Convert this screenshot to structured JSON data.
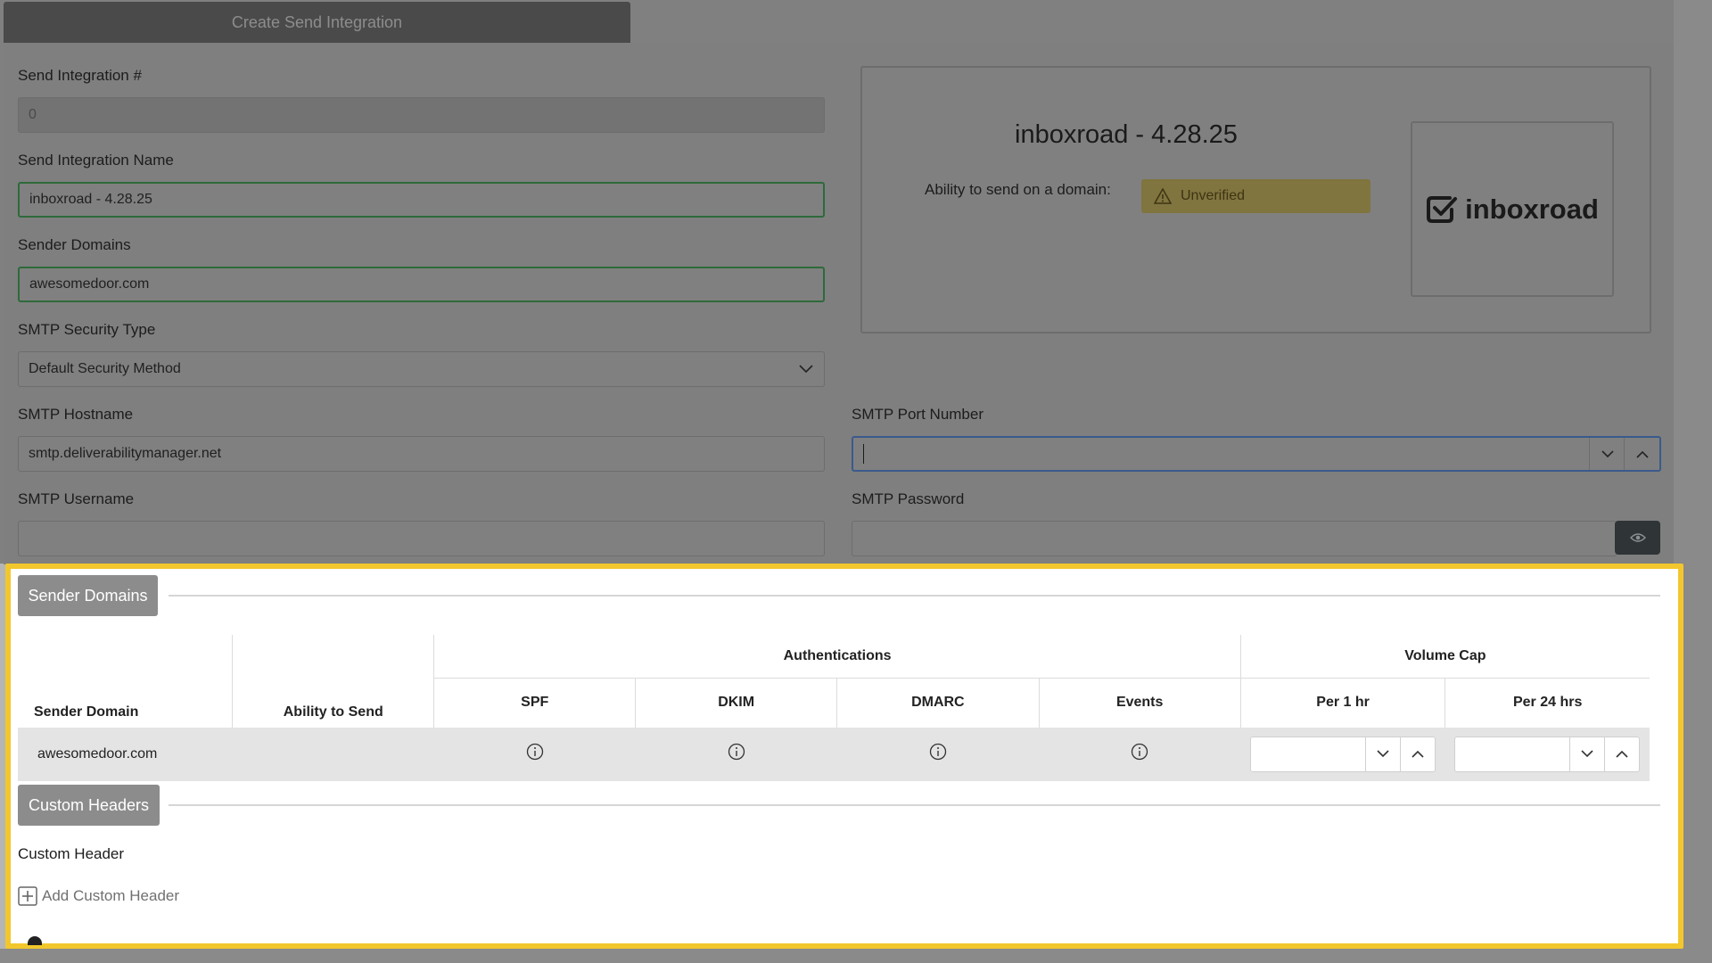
{
  "tab": {
    "title": "Create Send Integration"
  },
  "form": {
    "integration_num_label": "Send Integration #",
    "integration_num_value": "0",
    "integration_name_label": "Send Integration Name",
    "integration_name_value": "inboxroad - 4.28.25",
    "sender_domains_label": "Sender Domains",
    "sender_domains_value": "awesomedoor.com",
    "security_type_label": "SMTP Security Type",
    "security_type_value": "Default Security Method",
    "hostname_label": "SMTP Hostname",
    "hostname_value": "smtp.deliverabilitymanager.net",
    "port_label": "SMTP Port Number",
    "port_value": "",
    "username_label": "SMTP Username",
    "username_value": "",
    "password_label": "SMTP Password",
    "password_value": ""
  },
  "card": {
    "title": "inboxroad - 4.28.25",
    "ability_label": "Ability to send on a domain:",
    "status": "Unverified",
    "logo_text": "inboxroad"
  },
  "sender_domains_section": {
    "button": "Sender Domains",
    "group_headers": {
      "authentications": "Authentications",
      "volume_cap": "Volume Cap"
    },
    "columns": [
      "Sender Domain",
      "Ability to Send",
      "SPF",
      "DKIM",
      "DMARC",
      "Events",
      "Per 1 hr",
      "Per 24 hrs"
    ],
    "rows": [
      {
        "domain": "awesomedoor.com",
        "ability": ""
      }
    ]
  },
  "custom_headers_section": {
    "button": "Custom Headers",
    "label": "Custom Header",
    "add_label": "Add Custom Header"
  },
  "colors": {
    "highlight": "#f2c72d",
    "overlay": "#808080",
    "badge_warning": "#80743f"
  }
}
